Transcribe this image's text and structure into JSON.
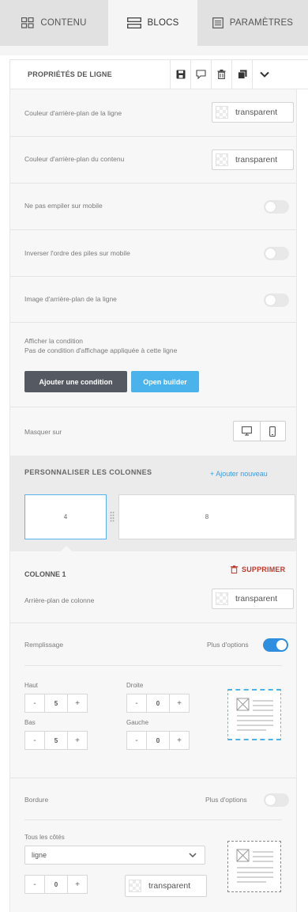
{
  "tabs": [
    {
      "label": "CONTENU",
      "icon": "grid-icon"
    },
    {
      "label": "BLOCS",
      "icon": "blocks-icon"
    },
    {
      "label": "PARAMÈTRES",
      "icon": "document-icon"
    }
  ],
  "header": {
    "title": "PROPRIÉTÉS DE LIGNE",
    "actions": [
      "save-icon",
      "comment-icon",
      "trash-icon",
      "duplicate-icon",
      "chevron-down-icon"
    ]
  },
  "rows": {
    "row_bg_label": "Couleur d'arrière-plan de la ligne",
    "row_bg_value": "transparent",
    "content_bg_label": "Couleur d'arrière-plan du contenu",
    "content_bg_value": "transparent",
    "no_stack_label": "Ne pas empiler sur mobile",
    "reverse_label": "Inverser l'ordre des piles sur mobile",
    "bg_image_label": "Image d'arrière-plan de la ligne",
    "condition_label": "Afficher la condition",
    "condition_note": "Pas de condition d'affichage appliquée à cette ligne",
    "add_condition": "Ajouter une condition",
    "open_builder": "Open builder",
    "hide_on_label": "Masquer sur"
  },
  "toggles": {
    "no_stack": false,
    "reverse": false,
    "bg_image": false,
    "padding_more": true,
    "border_more": false
  },
  "columns": {
    "title": "PERSONNALISER LES COLONNES",
    "add_label": "+ Ajouter nouveau",
    "sizes": [
      "4",
      "8"
    ]
  },
  "column1": {
    "title": "COLONNE 1",
    "delete_label": "SUPPRIMER",
    "bg_label": "Arrière-plan de colonne",
    "bg_value": "transparent",
    "padding_label": "Remplissage",
    "more_options": "Plus d'options",
    "top_label": "Haut",
    "top_value": "5",
    "right_label": "Droite",
    "right_value": "0",
    "bottom_label": "Bas",
    "bottom_value": "5",
    "left_label": "Gauche",
    "left_value": "0",
    "border_label": "Bordure",
    "border_more": "Plus d'options",
    "all_sides_label": "Tous les côtés",
    "border_style": "ligne",
    "border_width": "0",
    "border_color": "transparent"
  },
  "colors": {
    "accent": "#4ab3eb",
    "toggle_on": "#2e8fe0",
    "danger": "#c0392b",
    "dark_button": "#555a62"
  }
}
